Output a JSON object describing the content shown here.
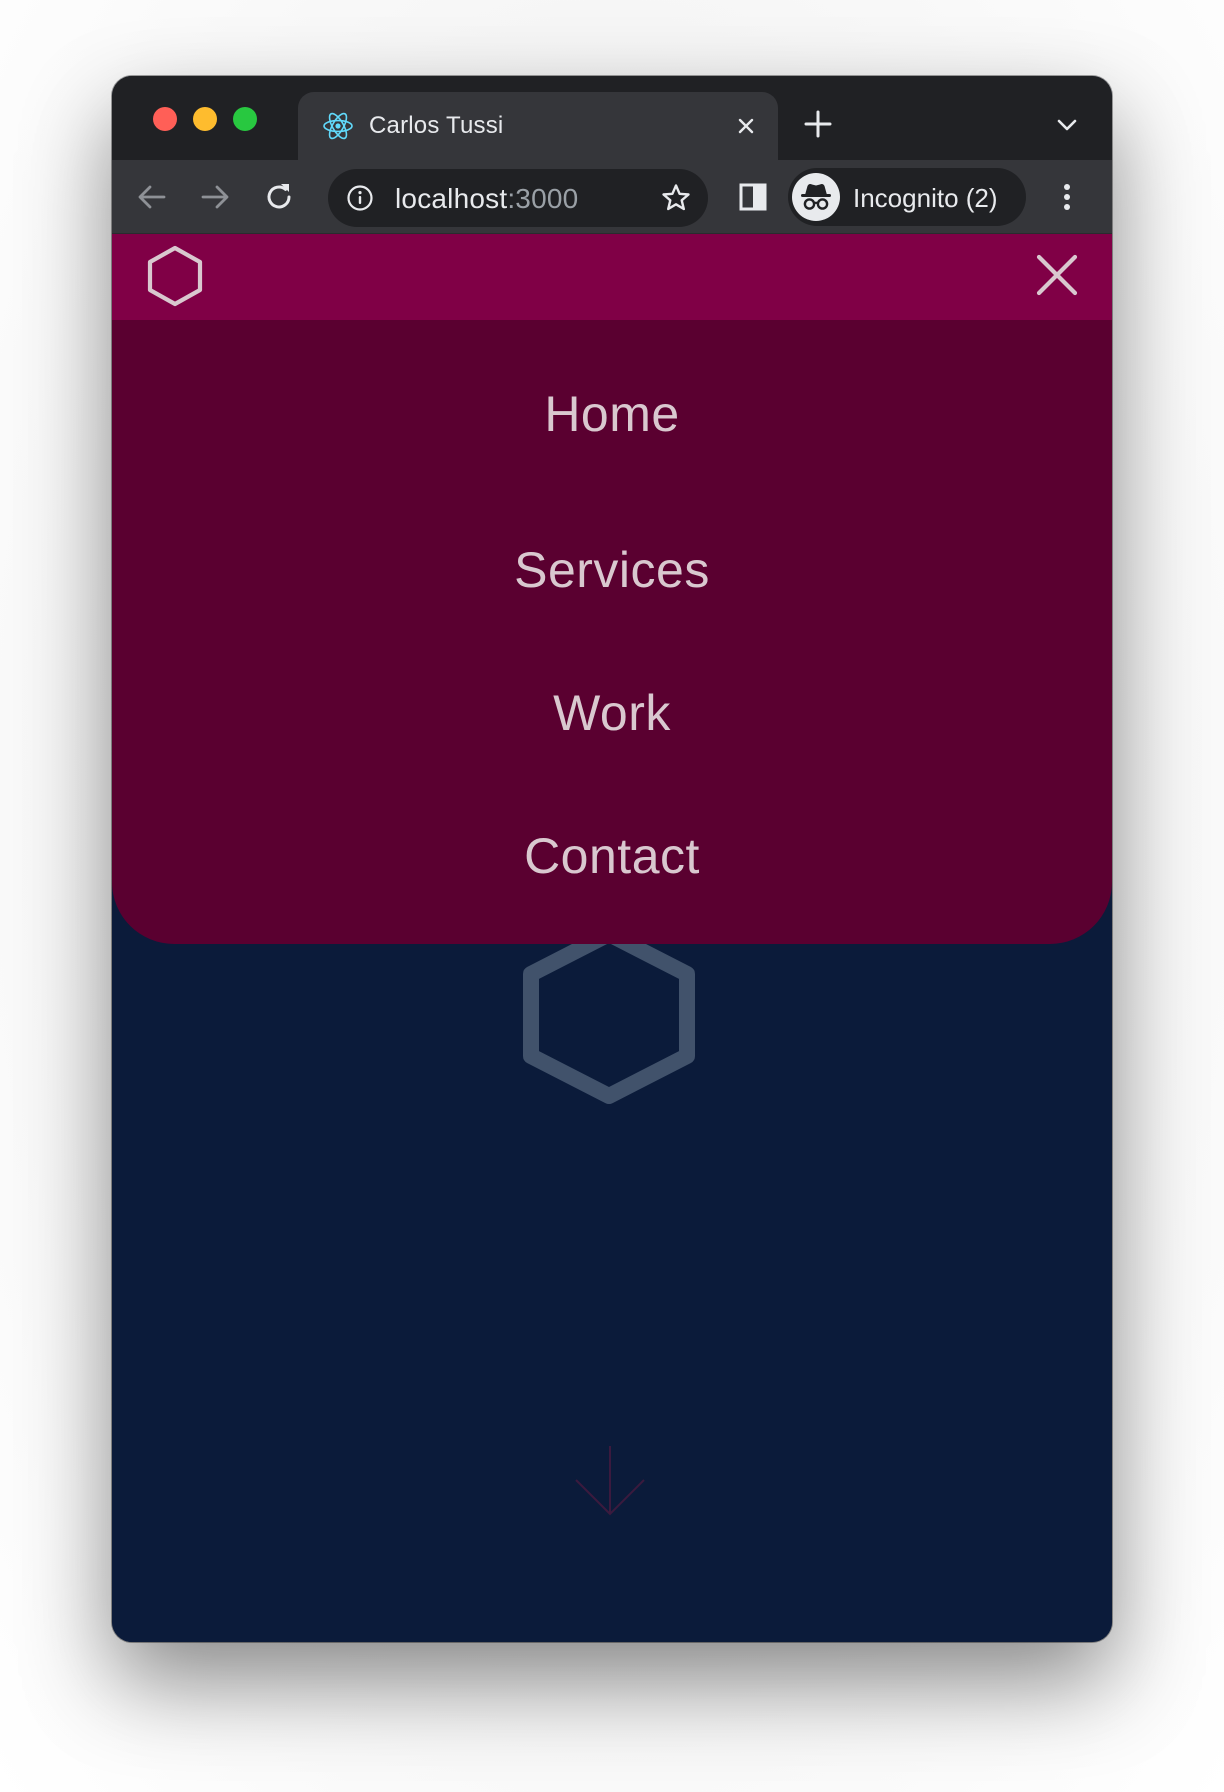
{
  "browser": {
    "tab": {
      "title": "Carlos Tussi",
      "favicon": "react-icon"
    },
    "address": {
      "host": "localhost",
      "port": ":3000"
    },
    "profile": {
      "label": "Incognito (2)"
    }
  },
  "page": {
    "menu": {
      "items": [
        "Home",
        "Services",
        "Work",
        "Contact"
      ]
    }
  },
  "colors": {
    "navbar": "#800046",
    "menu_panel": "#5a0030",
    "page_background": "#0b1b3a",
    "menu_text": "#d9c8cf",
    "hero_hexagon": "#41526b"
  }
}
